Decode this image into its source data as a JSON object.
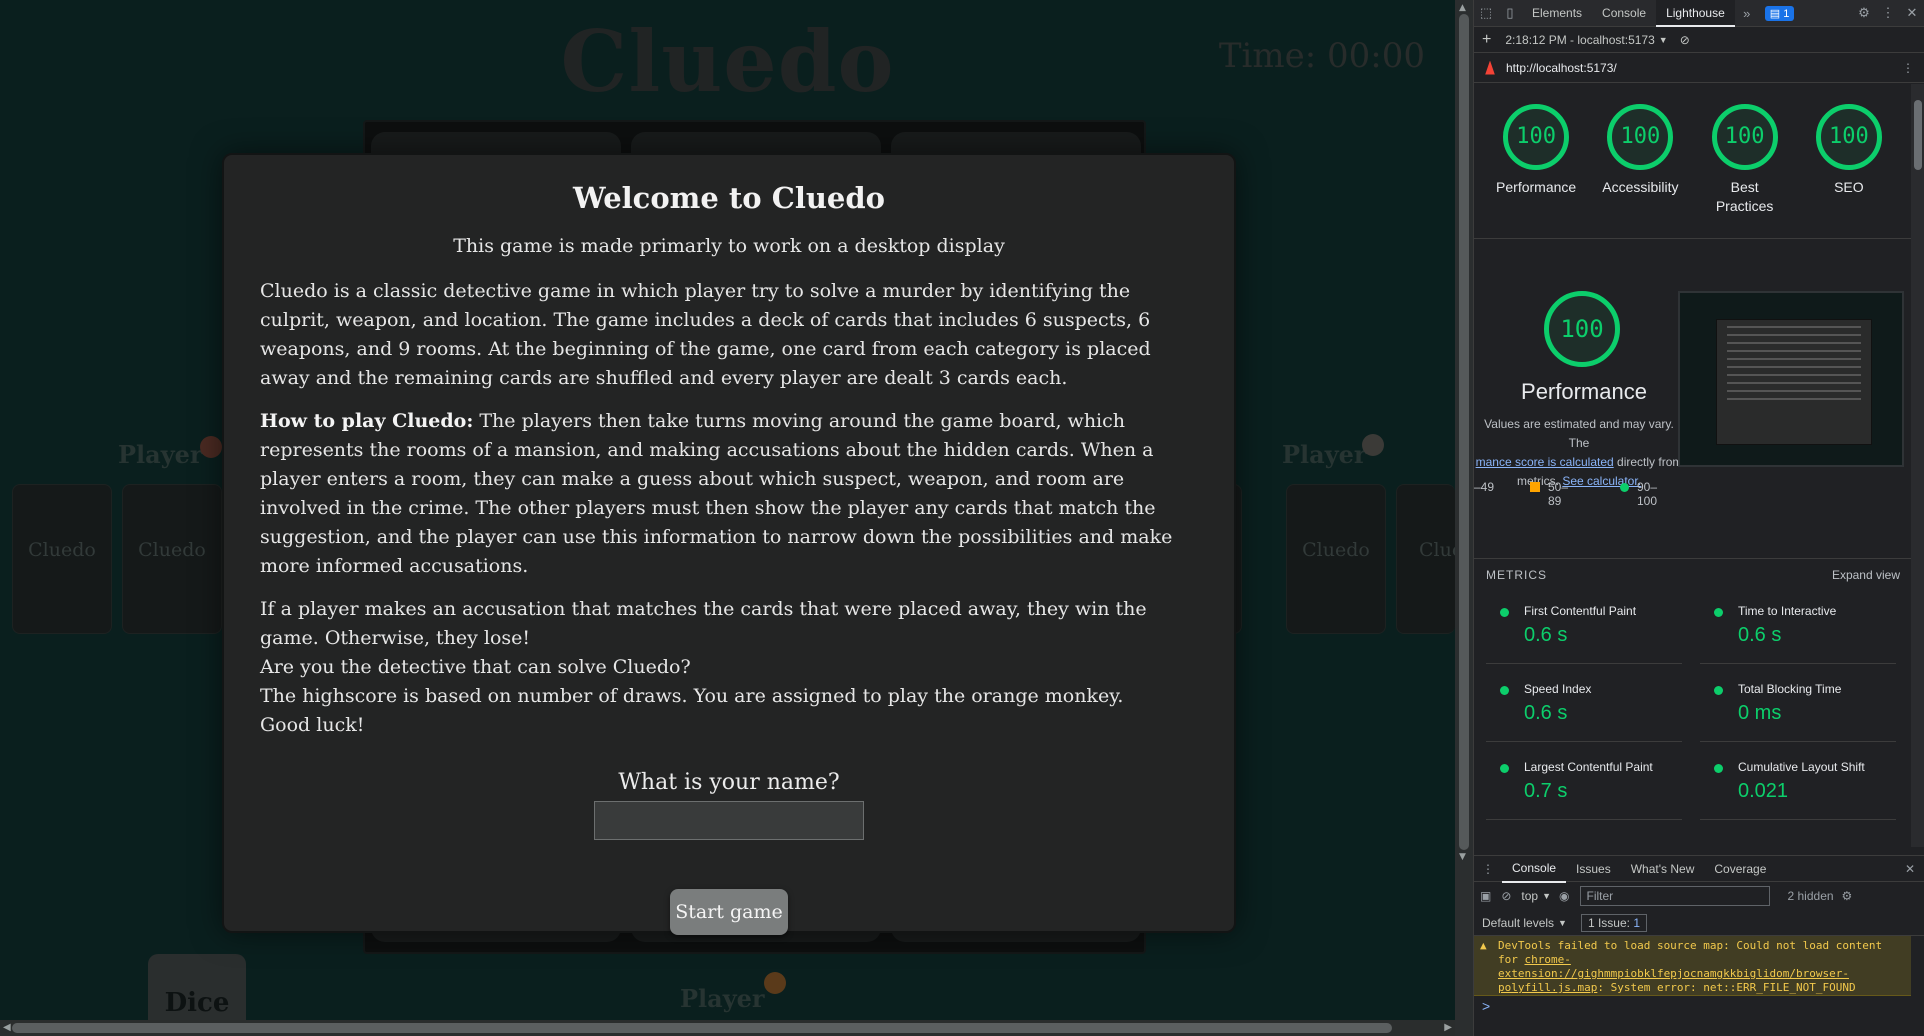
{
  "game": {
    "title": "Cluedo",
    "timer": "Time: 00:00",
    "player_label": "Player",
    "card_label": "Cluedo",
    "dice_label": "Dice"
  },
  "modal": {
    "heading": "Welcome to Cluedo",
    "subheading": "This game is made primarly to work on a desktop display",
    "para1": "Cluedo is a classic detective game in which player try to solve a murder by identifying the culprit, weapon, and location. The game includes a deck of cards that includes 6 suspects, 6 weapons, and 9 rooms. At the beginning of the game, one card from each category is placed away and the remaining cards are shuffled and every player are dealt 3 cards each.",
    "para2_bold": "How to play Cluedo:",
    "para2": " The players then take turns moving around the game board, which represents the rooms of a mansion, and making accusations about the hidden cards. When a player enters a room, they can make a guess about which suspect, weapon, and room are involved in the crime. The other players must then show the player any cards that match the suggestion, and the player can use this information to narrow down the possibilities and make more informed accusations.",
    "para3_lines": [
      "If a player makes an accusation that matches the cards that were placed away, they win the game. Otherwise, they lose!",
      "Are you the detective that can solve Cluedo?",
      "The highscore is based on number of draws. You are assigned to play the orange monkey.",
      "Good luck!"
    ],
    "name_question": "What is your name?",
    "name_value": "",
    "start_button": "Start game"
  },
  "devtools": {
    "tabs": [
      "Elements",
      "Console",
      "Lighthouse"
    ],
    "active_tab": "Lighthouse",
    "issues_badge": "1",
    "report_selector": "2:18:12 PM - localhost:5173",
    "url": "http://localhost:5173/",
    "gauges": [
      {
        "score": "100",
        "label": "Performance"
      },
      {
        "score": "100",
        "label": "Accessibility"
      },
      {
        "score": "100",
        "label": "Best Practices"
      },
      {
        "score": "100",
        "label": "SEO"
      }
    ],
    "perf": {
      "score": "100",
      "label": "Performance",
      "note_1": "Values are estimated and may vary. The",
      "note_link": "mance score is calculated",
      "note_2": " directly from",
      "note_3": "metrics. ",
      "note_calc": "See calculator.",
      "legend_low": "–49",
      "legend_mid": "50–89",
      "legend_high": "90–100"
    },
    "metrics_title": "METRICS",
    "expand_view": "Expand view",
    "metrics": [
      {
        "name": "First Contentful Paint",
        "value": "0.6 s"
      },
      {
        "name": "Time to Interactive",
        "value": "0.6 s"
      },
      {
        "name": "Speed Index",
        "value": "0.6 s"
      },
      {
        "name": "Total Blocking Time",
        "value": "0 ms"
      },
      {
        "name": "Largest Contentful Paint",
        "value": "0.7 s"
      },
      {
        "name": "Cumulative Layout Shift",
        "value": "0.021"
      }
    ],
    "drawer_tabs": [
      "Console",
      "Issues",
      "What's New",
      "Coverage"
    ],
    "context": "top",
    "filter_placeholder": "Filter",
    "hidden_count": "2 hidden",
    "default_levels": "Default levels",
    "issues_chip": "1 Issue:",
    "issues_chip_count": "1",
    "warning_prefix": "DevTools failed to load source map: Could not load content for ",
    "warning_link": "chrome-extension://gighmmpiobklfepjocnamgkkbiglidom/browser-polyfill.js.map",
    "warning_suffix": ": System error: net::ERR_FILE_NOT_FOUND",
    "prompt": ">"
  },
  "colors": {
    "accent_green": "#0cce6b",
    "orange": "#ffa400",
    "link_blue": "#8ab4f8"
  }
}
